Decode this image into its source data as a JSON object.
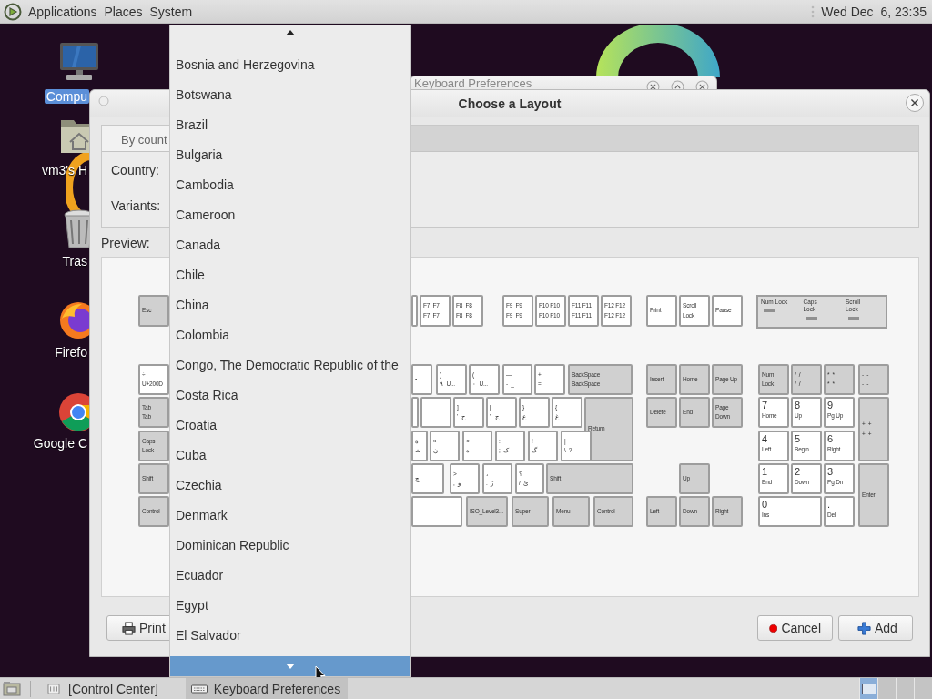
{
  "top_panel": {
    "menus": [
      "Applications",
      "Places",
      "System"
    ],
    "clock": "Wed Dec  6, 23:35"
  },
  "desktop_icons": [
    {
      "label": "Compu",
      "kind": "computer",
      "selected": true
    },
    {
      "label": "vm3's H",
      "kind": "home",
      "selected": false
    },
    {
      "label": "Tras",
      "kind": "trash",
      "selected": false
    },
    {
      "label": "Firefo",
      "kind": "firefox",
      "selected": false
    },
    {
      "label": "Google C",
      "kind": "chrome",
      "selected": false
    }
  ],
  "background_window": {
    "title": "Keyboard Preferences"
  },
  "dialog": {
    "title": "Choose a Layout",
    "tabs": [
      {
        "label": "By count",
        "selected": true
      }
    ],
    "country_label": "Country:",
    "variants_label": "Variants:",
    "preview_label": "Preview:",
    "keyboard": {
      "indicators": [
        {
          "label": "Num Lock",
          "on": false
        },
        {
          "label": "Caps Lock",
          "on": false
        },
        {
          "label": "Scroll Lock",
          "on": false
        }
      ],
      "keys": [
        {
          "kind": "modifier",
          "legend": [
            "Esc"
          ]
        },
        {
          "kind": "character"
        },
        {
          "kind": "character",
          "legend": [
            "F7  F7",
            "F7  F7"
          ]
        },
        {
          "kind": "character",
          "legend": [
            "F8  F8",
            "F8  F8"
          ]
        },
        {
          "kind": "character",
          "legend": [
            "F9  F9",
            "F9  F9"
          ]
        },
        {
          "kind": "character",
          "legend": [
            "F10 F10",
            "F10 F10"
          ]
        },
        {
          "kind": "character",
          "legend": [
            "F11 F11",
            "F11 F11"
          ]
        },
        {
          "kind": "character",
          "legend": [
            "F12 F12",
            "F12 F12"
          ]
        },
        {
          "kind": "character",
          "legend": [
            "Print"
          ]
        },
        {
          "kind": "character",
          "legend": [
            "Scroll Lock"
          ]
        },
        {
          "kind": "character",
          "legend": [
            "Pause"
          ]
        },
        {
          "kind": "character",
          "legend": [
            "÷",
            "U+200D"
          ]
        },
        {
          "kind": "character",
          "legend": [
            "•"
          ]
        },
        {
          "kind": "character",
          "legend": [
            ")",
            "٩  U..."
          ]
        },
        {
          "kind": "character",
          "legend": [
            "(",
            "٠  U..."
          ]
        },
        {
          "kind": "character",
          "legend": [
            "—",
            "-  _"
          ]
        },
        {
          "kind": "character",
          "legend": [
            "+",
            "="
          ]
        },
        {
          "kind": "modifier",
          "legend": [
            "BackSpace",
            "BackSpace"
          ]
        },
        {
          "kind": "modifier",
          "legend": [
            "Tab",
            "Tab"
          ]
        },
        {
          "kind": "character"
        },
        {
          "kind": "character"
        },
        {
          "kind": "character",
          "legend": [
            "]",
            "'  ح"
          ]
        },
        {
          "kind": "character",
          "legend": [
            "[",
            "\"  ج"
          ]
        },
        {
          "kind": "character",
          "legend": [
            "}",
            "ع"
          ]
        },
        {
          "kind": "character",
          "legend": [
            "{",
            "غ"
          ]
        },
        {
          "kind": "modifier",
          "legend": [
            "Return"
          ]
        },
        {
          "kind": "modifier",
          "legend": [
            "Caps Lock"
          ]
        },
        {
          "kind": "character",
          "legend": [
            "ة",
            "ث"
          ]
        },
        {
          "kind": "character",
          "legend": [
            "»",
            "ن"
          ]
        },
        {
          "kind": "character",
          "legend": [
            "«",
            "ه"
          ]
        },
        {
          "kind": "character",
          "legend": [
            ":",
            ";  ک"
          ]
        },
        {
          "kind": "character",
          "legend": [
            "!",
            "گ"
          ]
        },
        {
          "kind": "character",
          "legend": [
            "|",
            "\\  ?"
          ]
        },
        {
          "kind": "modifier",
          "legend": [
            "Shift"
          ]
        },
        {
          "kind": "character",
          "legend": [
            "چ"
          ]
        },
        {
          "kind": "character",
          "legend": [
            ">",
            ",  و"
          ]
        },
        {
          "kind": "character",
          "legend": [
            "،",
            ".  ژ"
          ]
        },
        {
          "kind": "character",
          "legend": [
            "؟",
            "/  ئ"
          ]
        },
        {
          "kind": "modifier",
          "legend": [
            "Shift"
          ]
        },
        {
          "kind": "modifier",
          "legend": [
            "Control"
          ]
        },
        {
          "kind": "character"
        },
        {
          "kind": "modifier",
          "legend": [
            "ISO_Level3..."
          ]
        },
        {
          "kind": "modifier",
          "legend": [
            "Super"
          ]
        },
        {
          "kind": "modifier",
          "legend": [
            "Menu"
          ]
        },
        {
          "kind": "modifier",
          "legend": [
            "Control"
          ]
        },
        {
          "kind": "modifier",
          "legend": [
            "Insert"
          ]
        },
        {
          "kind": "modifier",
          "legend": [
            "Home"
          ]
        },
        {
          "kind": "modifier",
          "legend": [
            "Page Up"
          ]
        },
        {
          "kind": "modifier",
          "legend": [
            "Delete"
          ]
        },
        {
          "kind": "modifier",
          "legend": [
            "End"
          ]
        },
        {
          "kind": "modifier",
          "legend": [
            "Page Down"
          ]
        },
        {
          "kind": "modifier",
          "legend": [
            "Up"
          ]
        },
        {
          "kind": "modifier",
          "legend": [
            "Left"
          ]
        },
        {
          "kind": "modifier",
          "legend": [
            "Down"
          ]
        },
        {
          "kind": "modifier",
          "legend": [
            "Right"
          ]
        },
        {
          "kind": "modifier",
          "legend": [
            "Num Lock"
          ]
        },
        {
          "kind": "modifier",
          "legend": [
            "/  /",
            "/  /"
          ]
        },
        {
          "kind": "modifier",
          "legend": [
            "*  *",
            "*  *"
          ]
        },
        {
          "kind": "modifier",
          "legend": [
            "-  -",
            "-  -"
          ]
        },
        {
          "kind": "digit",
          "legend": [
            "7",
            "Home"
          ]
        },
        {
          "kind": "digit",
          "legend": [
            "8",
            "Up"
          ]
        },
        {
          "kind": "digit",
          "legend": [
            "9",
            "Pg Up"
          ]
        },
        {
          "kind": "modifier",
          "legend": [
            "+  +",
            "+  +"
          ]
        },
        {
          "kind": "digit",
          "legend": [
            "4",
            "Left"
          ]
        },
        {
          "kind": "digit",
          "legend": [
            "5",
            "Begin"
          ]
        },
        {
          "kind": "digit",
          "legend": [
            "6",
            "Right"
          ]
        },
        {
          "kind": "digit",
          "legend": [
            "1",
            "End"
          ]
        },
        {
          "kind": "digit",
          "legend": [
            "2",
            "Down"
          ]
        },
        {
          "kind": "digit",
          "legend": [
            "3",
            "Pg Dn"
          ]
        },
        {
          "kind": "modifier",
          "legend": [
            "Enter"
          ]
        },
        {
          "kind": "digit",
          "legend": [
            "0",
            "Ins"
          ]
        },
        {
          "kind": "digit",
          "legend": [
            ".",
            "Del"
          ]
        }
      ]
    },
    "buttons": [
      {
        "label": "Print",
        "kind": "print"
      },
      {
        "label": "Cancel",
        "kind": "cancel"
      },
      {
        "label": "Add",
        "kind": "add"
      }
    ]
  },
  "dropdown": {
    "items": [
      {
        "label": "Bosnia and Herzegovina",
        "selected": false
      },
      {
        "label": "Botswana",
        "selected": false
      },
      {
        "label": "Brazil",
        "selected": false
      },
      {
        "label": "Bulgaria",
        "selected": false
      },
      {
        "label": "Cambodia",
        "selected": false
      },
      {
        "label": "Cameroon",
        "selected": false
      },
      {
        "label": "Canada",
        "selected": false
      },
      {
        "label": "Chile",
        "selected": false
      },
      {
        "label": "China",
        "selected": false
      },
      {
        "label": "Colombia",
        "selected": false
      },
      {
        "label": "Congo, The Democratic Republic of the",
        "selected": false
      },
      {
        "label": "Costa Rica",
        "selected": false
      },
      {
        "label": "Croatia",
        "selected": false
      },
      {
        "label": "Cuba",
        "selected": false
      },
      {
        "label": "Czechia",
        "selected": false
      },
      {
        "label": "Denmark",
        "selected": false
      },
      {
        "label": "Dominican Republic",
        "selected": false
      },
      {
        "label": "Ecuador",
        "selected": false
      },
      {
        "label": "Egypt",
        "selected": false
      },
      {
        "label": "El Salvador",
        "selected": false
      }
    ]
  },
  "taskbar": {
    "tasks": [
      {
        "label": "[Control Center]",
        "kind": "settings",
        "selected": false
      },
      {
        "label": "Keyboard Preferences",
        "kind": "keyboard",
        "selected": true
      }
    ],
    "workspaces": [
      {
        "selected": true
      },
      {
        "selected": false
      },
      {
        "selected": false
      },
      {
        "selected": false
      }
    ]
  }
}
